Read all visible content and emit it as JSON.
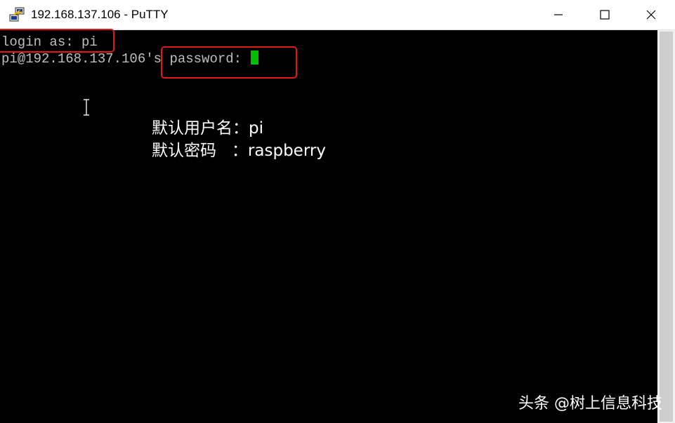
{
  "window": {
    "title": "192.168.137.106 - PuTTY",
    "icon": "putty-icon",
    "controls": {
      "minimize_icon": "minimize-icon",
      "maximize_icon": "maximize-icon",
      "close_icon": "close-icon"
    }
  },
  "terminal": {
    "lines": [
      "login as: pi",
      "pi@192.168.137.106's password: "
    ],
    "cursor_color": "#00c000",
    "text_color": "#bfbfbf",
    "background": "#000000"
  },
  "annotation": {
    "username_line": "默认用户名：pi",
    "password_line": "默认密码   ：raspberry",
    "highlight_color": "#e01818"
  },
  "watermark": "头条 @树上信息科技"
}
